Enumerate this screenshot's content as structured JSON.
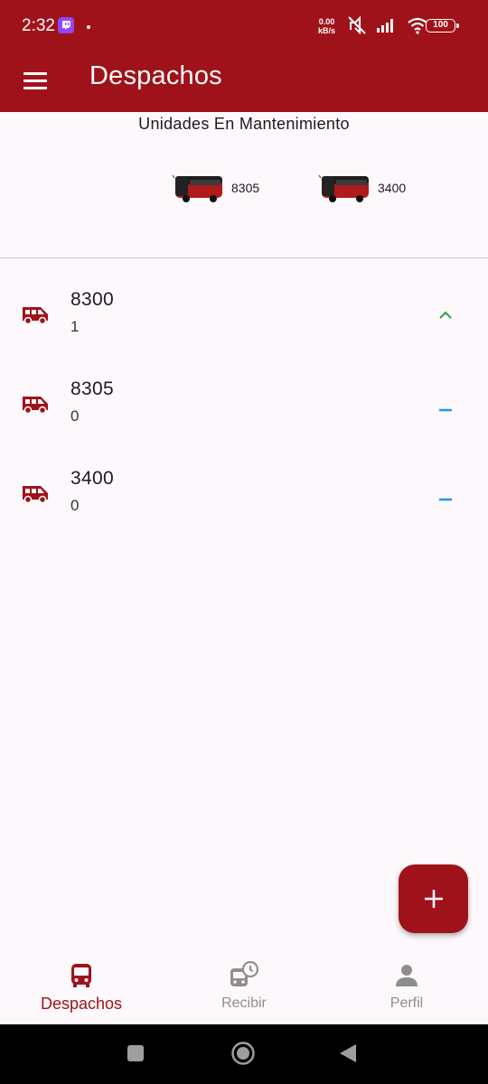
{
  "status_bar": {
    "time": "2:32",
    "net_speed_value": "0.00",
    "net_speed_unit": "kB/s",
    "battery": "100"
  },
  "app_bar": {
    "title": "Despachos"
  },
  "maintenance": {
    "title": "Unidades En Mantenimiento",
    "units": [
      {
        "label": "8305",
        "icon": "bus-icon"
      },
      {
        "label": "3400",
        "icon": "bus-icon"
      }
    ]
  },
  "units_list": [
    {
      "number": "8300",
      "count": "1",
      "trend": "up",
      "trend_color": "#2e9e3f"
    },
    {
      "number": "8305",
      "count": "0",
      "trend": "flat",
      "trend_color": "#2196f3"
    },
    {
      "number": "3400",
      "count": "0",
      "trend": "flat",
      "trend_color": "#2196f3"
    }
  ],
  "fab": {
    "icon": "plus-icon"
  },
  "bottom_nav": [
    {
      "label": "Despachos",
      "icon": "bus-front-icon",
      "active": true
    },
    {
      "label": "Recibir",
      "icon": "bus-clock-icon",
      "active": false
    },
    {
      "label": "Perfil",
      "icon": "person-icon",
      "active": false
    }
  ],
  "colors": {
    "primary": "#a0121a",
    "background": "#fdf8fc",
    "inactive": "#8e8e8e"
  }
}
